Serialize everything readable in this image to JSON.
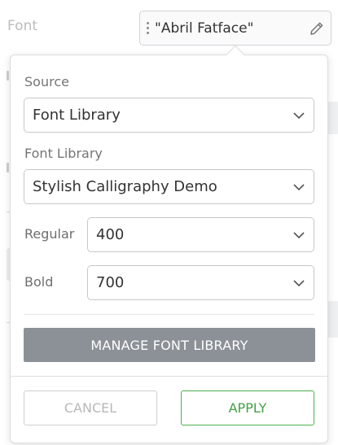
{
  "font_row": {
    "label": "Font",
    "value": "\"Abril Fatface\"",
    "drag_icon": "drag-handle-icon",
    "edit_icon": "pencil-icon"
  },
  "popover": {
    "source": {
      "label": "Source",
      "value": "Font Library"
    },
    "font_library": {
      "label": "Font Library",
      "value": "Stylish Calligraphy Demo"
    },
    "regular": {
      "label": "Regular",
      "value": "400"
    },
    "bold": {
      "label": "Bold",
      "value": "700"
    },
    "manage_label": "MANAGE FONT LIBRARY",
    "cancel_label": "CANCEL",
    "apply_label": "APPLY"
  },
  "colors": {
    "apply_green": "#43a047",
    "manage_gray": "#8c9197"
  }
}
